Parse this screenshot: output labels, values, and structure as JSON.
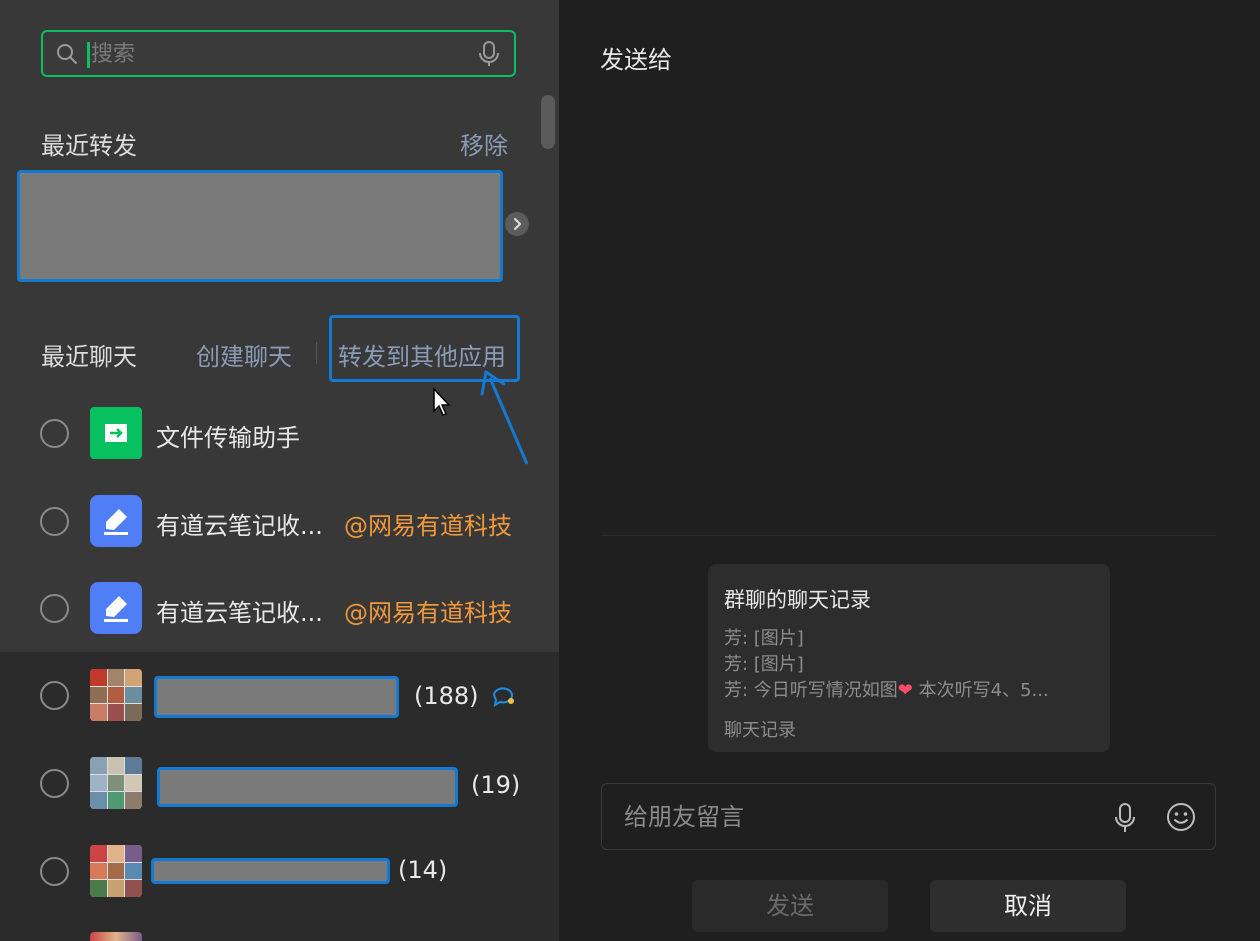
{
  "search": {
    "placeholder": "搜索"
  },
  "recent_forward": {
    "title": "最近转发",
    "remove_label": "移除"
  },
  "recent_chats": {
    "title": "最近聊天",
    "create_label": "创建聊天",
    "forward_other_label": "转发到其他应用",
    "items": [
      {
        "name": "文件传输助手"
      },
      {
        "name": "有道云笔记收...",
        "tag": "@网易有道科技"
      },
      {
        "name": "有道云笔记收...",
        "tag": "@网易有道科技"
      },
      {
        "count": "(188)"
      },
      {
        "count": "(19)"
      },
      {
        "count": "(14)"
      }
    ]
  },
  "right": {
    "title": "发送给",
    "card": {
      "title": "群聊的聊天记录",
      "lines": [
        "芳: [图片]",
        "芳: [图片]",
        "芳: 今日听写情况如图"
      ],
      "line3_suffix": " 本次听写4、5...",
      "footer": "聊天记录"
    },
    "message": {
      "placeholder": "给朋友留言"
    },
    "send_label": "发送",
    "cancel_label": "取消"
  },
  "colors": {
    "accent_green": "#07c160",
    "highlight_blue": "#1479d3",
    "tag_orange": "#f0983a"
  }
}
